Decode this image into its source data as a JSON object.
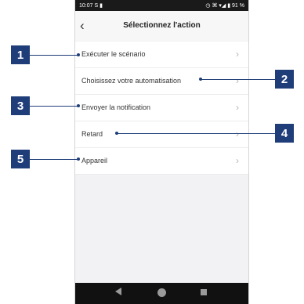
{
  "statusbar": {
    "time": "10:07",
    "left_icons": "S ▮",
    "right_icons": "◷ ⌘ ▾◢ ▮ 91 %"
  },
  "header": {
    "back_glyph": "‹",
    "title": "Sélectionnez l'action"
  },
  "list": {
    "items": [
      {
        "label": "Exécuter le scénario",
        "chevron": "›"
      },
      {
        "label": "Choisissez votre automatisation",
        "chevron": "›"
      },
      {
        "label": "Envoyer la notification",
        "chevron": "›"
      },
      {
        "label": "Retard",
        "chevron": "›"
      },
      {
        "label": "Appareil",
        "chevron": "›"
      }
    ]
  },
  "callouts": [
    "1",
    "2",
    "3",
    "4",
    "5"
  ],
  "colors": {
    "callout": "#1f3d78",
    "screen_bg": "#f2f2f4"
  },
  "navbar": {
    "icons": [
      "back-icon",
      "home-icon",
      "recents-icon"
    ]
  }
}
